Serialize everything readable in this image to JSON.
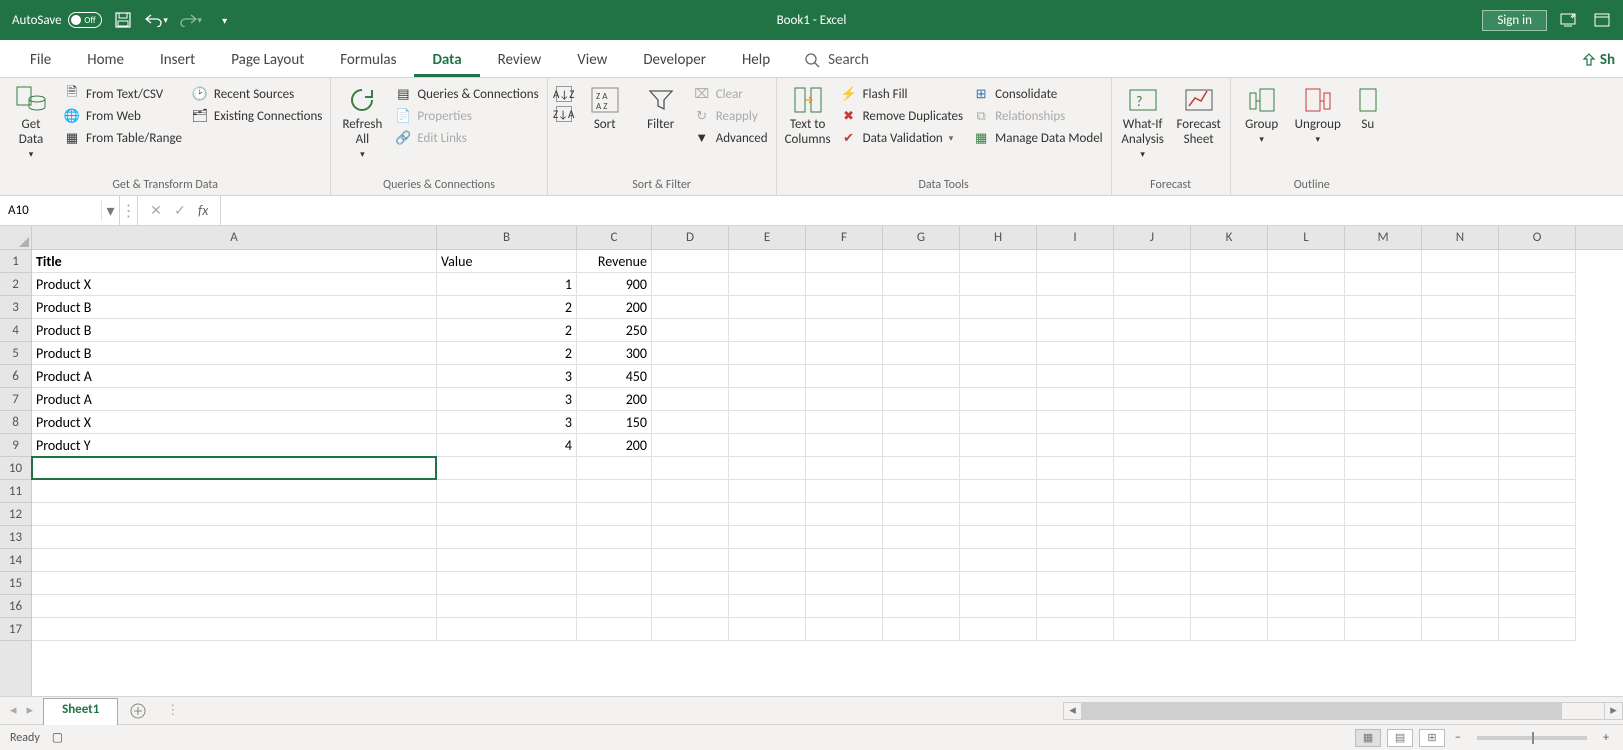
{
  "title_bar": {
    "autosave_label": "AutoSave",
    "autosave_state": "Off",
    "doc_title": "Book1  -  Excel",
    "signin_label": "Sign in"
  },
  "tabs": {
    "file": "File",
    "home": "Home",
    "insert": "Insert",
    "page_layout": "Page Layout",
    "formulas": "Formulas",
    "data": "Data",
    "review": "Review",
    "view": "View",
    "developer": "Developer",
    "help": "Help",
    "search_placeholder": "Search",
    "share": "Sh"
  },
  "ribbon": {
    "get_transform": {
      "get_data": "Get\nData",
      "from_text_csv": "From Text/CSV",
      "from_web": "From Web",
      "from_table_range": "From Table/Range",
      "recent_sources": "Recent Sources",
      "existing_connections": "Existing Connections",
      "label": "Get & Transform Data"
    },
    "queries": {
      "refresh_all": "Refresh\nAll",
      "queries_connections": "Queries & Connections",
      "properties": "Properties",
      "edit_links": "Edit Links",
      "label": "Queries & Connections"
    },
    "sort_filter": {
      "sort": "Sort",
      "filter": "Filter",
      "clear": "Clear",
      "reapply": "Reapply",
      "advanced": "Advanced",
      "label": "Sort & Filter"
    },
    "data_tools": {
      "text_to_columns": "Text to\nColumns",
      "flash_fill": "Flash Fill",
      "remove_duplicates": "Remove Duplicates",
      "data_validation": "Data Validation",
      "consolidate": "Consolidate",
      "relationships": "Relationships",
      "manage_data_model": "Manage Data Model",
      "label": "Data Tools"
    },
    "forecast": {
      "whatif": "What-If\nAnalysis",
      "forecast_sheet": "Forecast\nSheet",
      "label": "Forecast"
    },
    "outline": {
      "group": "Group",
      "ungroup": "Ungroup",
      "subtotal": "Su",
      "label": "Outline"
    }
  },
  "formula_bar": {
    "name_box": "A10",
    "formula": ""
  },
  "grid": {
    "col_widths": {
      "A": 405,
      "B": 140,
      "C": 75,
      "rest": 77
    },
    "columns": [
      "A",
      "B",
      "C",
      "D",
      "E",
      "F",
      "G",
      "H",
      "I",
      "J",
      "K",
      "L",
      "M",
      "N",
      "O"
    ],
    "row_count": 17,
    "active_cell": "A10",
    "data": [
      {
        "A": "Title",
        "B": "Value",
        "C": "Revenue",
        "header": true
      },
      {
        "A": "Product X",
        "B": 1,
        "C": 900
      },
      {
        "A": "Product B",
        "B": 2,
        "C": 200
      },
      {
        "A": "Product B",
        "B": 2,
        "C": 250
      },
      {
        "A": "Product B",
        "B": 2,
        "C": 300
      },
      {
        "A": "Product A",
        "B": 3,
        "C": 450
      },
      {
        "A": "Product A",
        "B": 3,
        "C": 200
      },
      {
        "A": "Product X",
        "B": 3,
        "C": 150
      },
      {
        "A": "Product Y",
        "B": 4,
        "C": 200
      }
    ]
  },
  "sheet_bar": {
    "sheet1": "Sheet1"
  },
  "status_bar": {
    "ready": "Ready",
    "zoom": "100%"
  }
}
